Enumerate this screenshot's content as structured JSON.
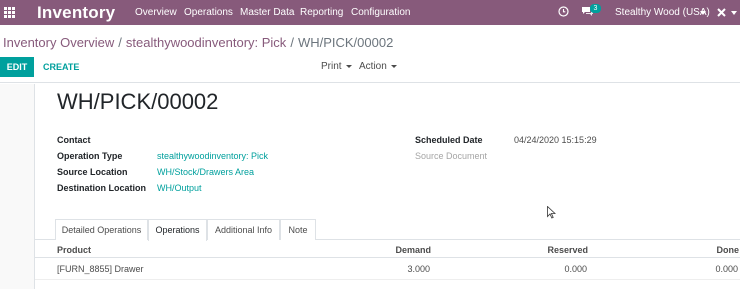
{
  "navbar": {
    "brand": "Inventory",
    "menu": [
      "Overview",
      "Operations",
      "Master Data",
      "Reporting",
      "Configuration"
    ],
    "chat_count": "3",
    "company": "Stealthy Wood (USA)"
  },
  "breadcrumb": {
    "items": [
      "Inventory Overview",
      "stealthywoodinventory: Pick"
    ],
    "current": "WH/PICK/00002"
  },
  "toolbar": {
    "edit_label": "EDIT",
    "create_label": "CREATE",
    "print_label": "Print",
    "action_label": "Action"
  },
  "record": {
    "name": "WH/PICK/00002",
    "contact_label": "Contact",
    "contact_value": "",
    "operation_type_label": "Operation Type",
    "operation_type_value": "stealthywoodinventory: Pick",
    "source_location_label": "Source Location",
    "source_location_value": "WH/Stock/Drawers Area",
    "destination_location_label": "Destination Location",
    "destination_location_value": "WH/Output",
    "scheduled_date_label": "Scheduled Date",
    "scheduled_date_value": "04/24/2020 15:15:29",
    "source_document_label": "Source Document",
    "source_document_value": ""
  },
  "tabs": [
    "Detailed Operations",
    "Operations",
    "Additional Info",
    "Note"
  ],
  "active_tab": "Operations",
  "operations_table": {
    "columns": [
      "Product",
      "Demand",
      "Reserved",
      "Done"
    ],
    "rows": [
      {
        "product": "[FURN_8855] Drawer",
        "demand": "3.000",
        "reserved": "0.000",
        "done": "0.000"
      }
    ]
  },
  "colors": {
    "navbar": "#875a7b",
    "accent": "#00a09d"
  }
}
